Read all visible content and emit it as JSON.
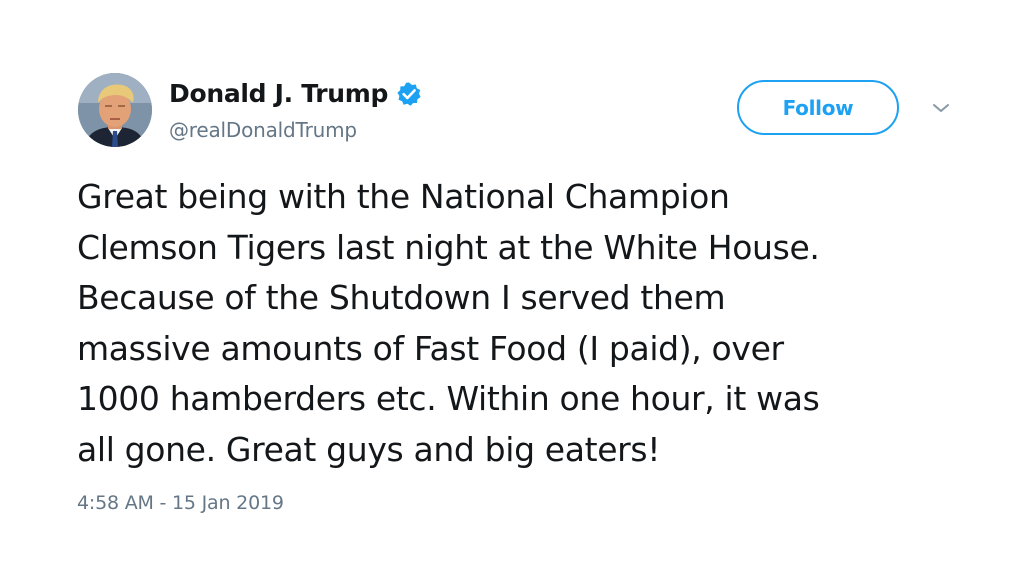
{
  "author": {
    "display_name": "Donald J. Trump",
    "handle": "@realDonaldTrump",
    "verified": true,
    "avatar_icon": "profile-photo"
  },
  "header": {
    "follow_label": "Follow",
    "menu_icon": "chevron-down-icon"
  },
  "tweet": {
    "lines": [
      "Great being with the National Champion",
      "Clemson Tigers last night at the White House.",
      "Because of the Shutdown I served them",
      "massive amounts of Fast Food (I paid), over",
      "1000 hamberders etc. Within one hour, it was",
      "all gone. Great guys and big eaters!"
    ],
    "timestamp": "4:58 AM - 15 Jan 2019"
  },
  "colors": {
    "accent": "#1da1f2",
    "text": "#14171a",
    "secondary_text": "#657786",
    "background": "#ffffff"
  }
}
